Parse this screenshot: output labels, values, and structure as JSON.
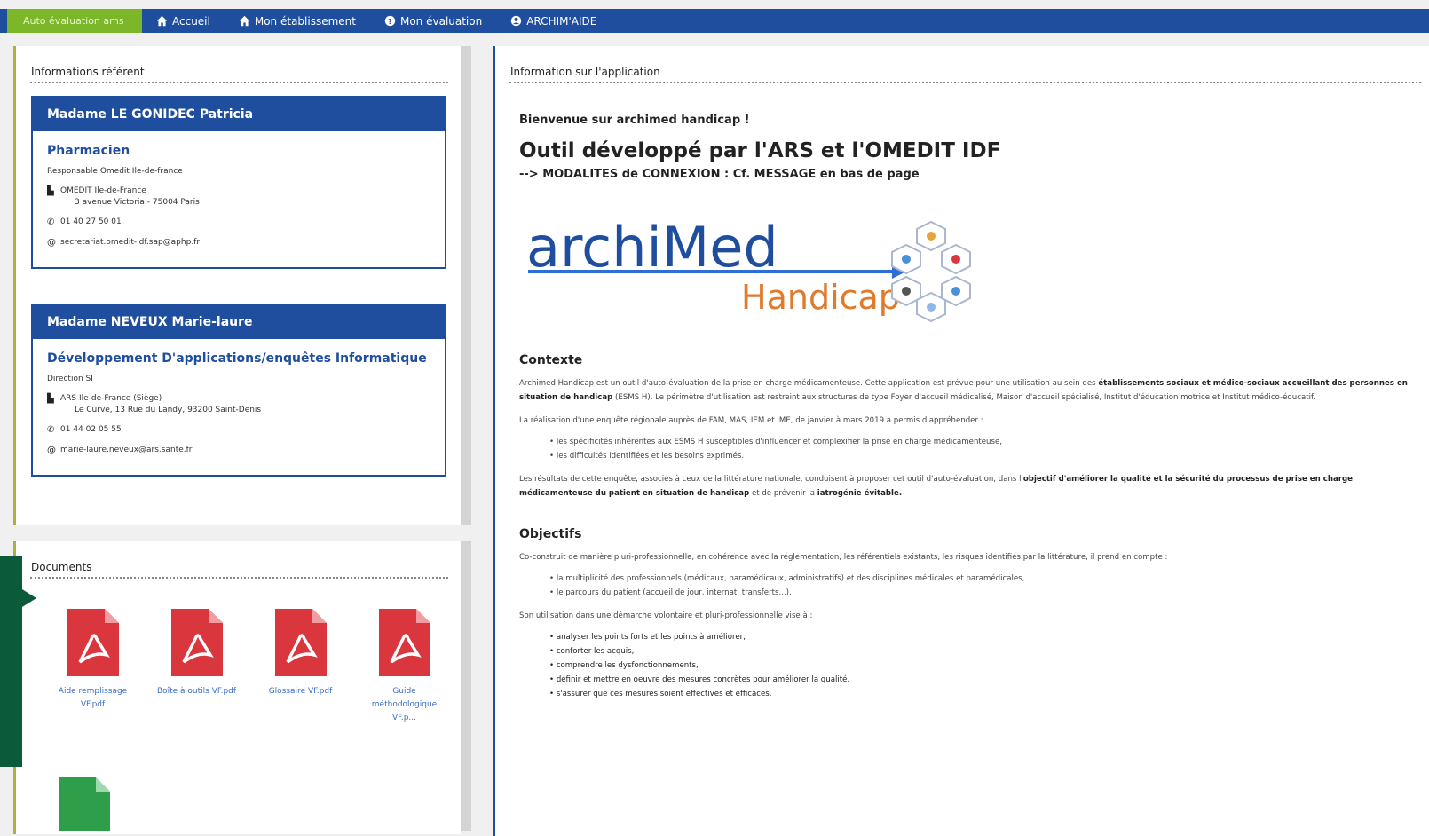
{
  "navbar": {
    "brand": "Auto évaluation ams",
    "items": [
      {
        "label": "Accueil",
        "icon": "home-icon"
      },
      {
        "label": "Mon établissement",
        "icon": "home-icon"
      },
      {
        "label": "Mon évaluation",
        "icon": "question-circle-icon"
      },
      {
        "label": "ARCHIM'AIDE",
        "icon": "user-circle-icon"
      }
    ]
  },
  "referents": {
    "title": "Informations référent",
    "cards": [
      {
        "name": "Madame LE GONIDEC Patricia",
        "role": "Pharmacien",
        "position": "Responsable Omedit Ile-de-france",
        "org": "OMEDIT Ile-de-France",
        "address": "3 avenue Victoria - 75004 Paris",
        "phone": "01 40 27 50 01",
        "email": "secretariat.omedit-idf.sap@aphp.fr"
      },
      {
        "name": "Madame NEVEUX Marie-laure",
        "role": "Développement D'applications/enquêtes Informatique",
        "position": "Direction SI",
        "org": "ARS Ile-de-France (Siège)",
        "address": "Le Curve, 13 Rue du Landy, 93200 Saint-Denis",
        "phone": "01 44 02 05 55",
        "email": "marie-laure.neveux@ars.sante.fr"
      }
    ]
  },
  "documents": {
    "title": "Documents",
    "items": [
      {
        "label": "Aide remplissage VF.pdf",
        "type": "pdf"
      },
      {
        "label": "Boîte à outils VF.pdf",
        "type": "pdf"
      },
      {
        "label": "Glossaire VF.pdf",
        "type": "pdf"
      },
      {
        "label": "Guide méthodologique VF.p...",
        "type": "pdf"
      }
    ]
  },
  "info": {
    "title": "Information sur l'application",
    "welcome": "Bienvenue sur archimed handicap !",
    "heading": "Outil développé par l'ARS et l'OMEDIT IDF",
    "modalites": "--> MODALITES de CONNEXION : Cf. MESSAGE en bas de page",
    "logo_main": "archiMed",
    "logo_sub": "Handicap",
    "contexte_title": "Contexte",
    "contexte_p1_a": "Archimed Handicap est un outil d'auto-évaluation de la prise en charge médicamenteuse. Cette application est prévue pour une utilisation au sein des ",
    "contexte_p1_b": "établissements sociaux et médico-sociaux accueillant des personnes en situation de handicap",
    "contexte_p1_c": " (ESMS H). Le périmètre d'utilisation est restreint aux structures de type Foyer d'accueil médicalisé, Maison d'accueil spécialisé, Institut d'éducation motrice et Institut médico-éducatif.",
    "contexte_p2": "La réalisation d'une enquête régionale auprès de FAM, MAS, IEM et IME, de janvier à mars 2019 a permis d'appréhender :",
    "contexte_bullets": [
      "les spécificités inhérentes aux ESMS H susceptibles d'influencer et complexifier la prise en charge médicamenteuse,",
      "les difficultés identifiées et les besoins exprimés."
    ],
    "contexte_p3_a": "Les résultats de cette enquête, associés à ceux de la littérature nationale, conduisent à proposer cet outil d'auto-évaluation, dans l'",
    "contexte_p3_b": "objectif d'améliorer la qualité et la sécurité du processus de prise en charge médicamenteuse du patient en situation de handicap",
    "contexte_p3_c": " et de prévenir la ",
    "contexte_p3_d": "iatrogénie évitable.",
    "objectifs_title": "Objectifs",
    "objectifs_p1": "Co-construit de manière pluri-professionnelle, en cohérence avec la réglementation, les référentiels existants, les risques identifiés par la littérature, il prend en compte :",
    "objectifs_bullets": [
      "la multiplicité des professionnels (médicaux, paramédicaux, administratifs) et des disciplines médicales et paramédicales,",
      "le parcours du patient (accueil de jour, internat, transferts...)."
    ],
    "objectifs_p2": "Son utilisation dans une démarche volontaire et pluri-professionnelle vise à :",
    "objectifs_goals": [
      "analyser les points forts et les points à améliorer,",
      "conforter les acquis,",
      "comprendre les dysfonctionnements,",
      "définir et mettre en oeuvre des mesures concrètes pour améliorer la qualité,",
      "s'assurer que ces mesures soient effectives et efficaces."
    ]
  },
  "colors": {
    "navbar": "#1f4e9e",
    "brand": "#7cb629",
    "pdf": "#d9363e",
    "link": "#3a6fc2",
    "sidetab": "#0b5a3a"
  }
}
